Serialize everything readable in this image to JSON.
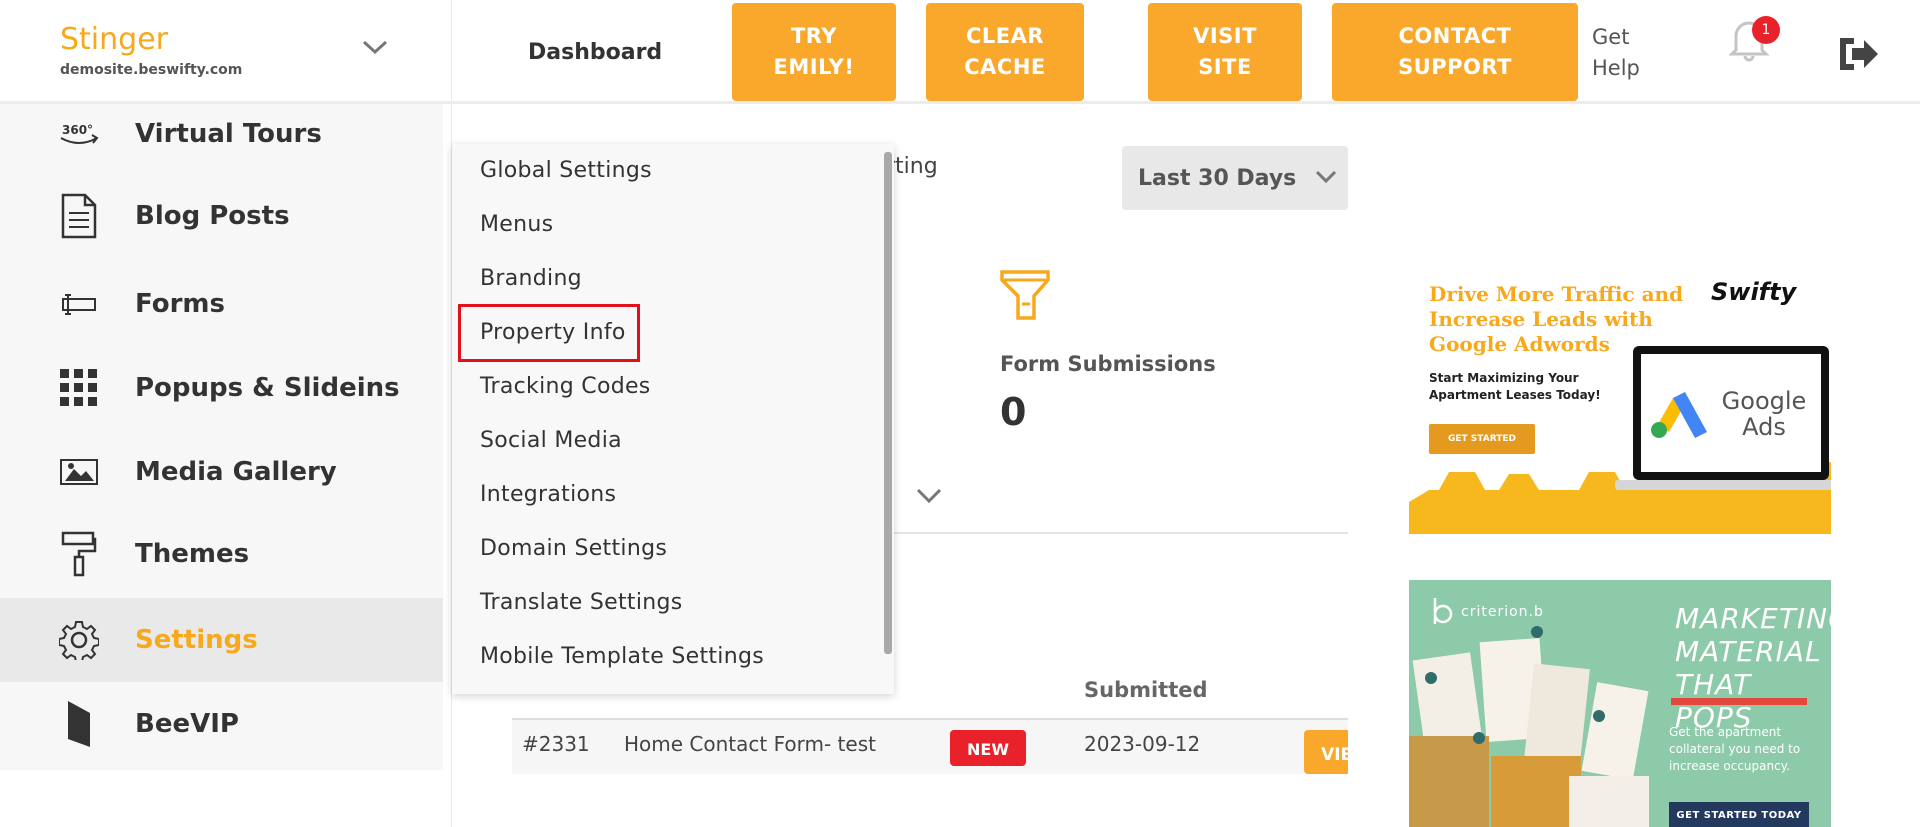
{
  "brand": {
    "name": "Stinger",
    "domain": "demosite.beswifty.com"
  },
  "topbar": {
    "title": "Dashboard",
    "buttons": [
      {
        "label": "TRY\nEMILY!"
      },
      {
        "label": "CLEAR\nCACHE"
      },
      {
        "label": "VISIT\nSITE"
      },
      {
        "label": "CONTACT\nSUPPORT"
      }
    ],
    "get_help": "Get\nHelp",
    "notification_count": "1"
  },
  "sidebar": {
    "items": [
      {
        "label": "Virtual Tours",
        "icon": "360-icon"
      },
      {
        "label": "Blog Posts",
        "icon": "document-icon"
      },
      {
        "label": "Forms",
        "icon": "form-icon"
      },
      {
        "label": "Popups & Slideins",
        "icon": "grid-icon"
      },
      {
        "label": "Media Gallery",
        "icon": "image-icon"
      },
      {
        "label": "Themes",
        "icon": "paint-roller-icon"
      },
      {
        "label": "Settings",
        "icon": "gear-icon",
        "active": true
      },
      {
        "label": "BeeVIP",
        "icon": "beevip-icon"
      }
    ]
  },
  "settings_menu": {
    "items": [
      "Global Settings",
      "Menus",
      "Branding",
      "Property Info",
      "Tracking Codes",
      "Social Media",
      "Integrations",
      "Domain Settings",
      "Translate Settings",
      "Mobile Template Settings"
    ],
    "highlighted": "Property Info"
  },
  "main": {
    "partial_heading": "rting",
    "date_range": "Last 30 Days",
    "stat": {
      "label": "Form Submissions",
      "value": "0"
    },
    "table": {
      "headers": {
        "submitted": "Submitted"
      },
      "row": {
        "id": "#2331",
        "form_title": "Home Contact Form- test",
        "status": "NEW",
        "submitted": "2023-09-12",
        "action": "VIEW"
      }
    }
  },
  "ads": {
    "google": {
      "headline": "Drive More Traffic and Increase Leads with Google Adwords",
      "sub": "Start Maximizing Your Apartment Leases Today!",
      "button": "GET STARTED",
      "logo": "Swifty",
      "product": "Google Ads"
    },
    "criterion": {
      "brand": "criterion.b",
      "headline": "MARKETING MATERIAL THAT POPS",
      "sub": "Get the apartment collateral you need to increase occupancy.",
      "button": "GET STARTED TODAY"
    }
  },
  "colors": {
    "accent": "#f9a82c",
    "brand_text": "#f7a81b",
    "alert": "#e8212a",
    "ad_green": "#8ccaa9"
  }
}
